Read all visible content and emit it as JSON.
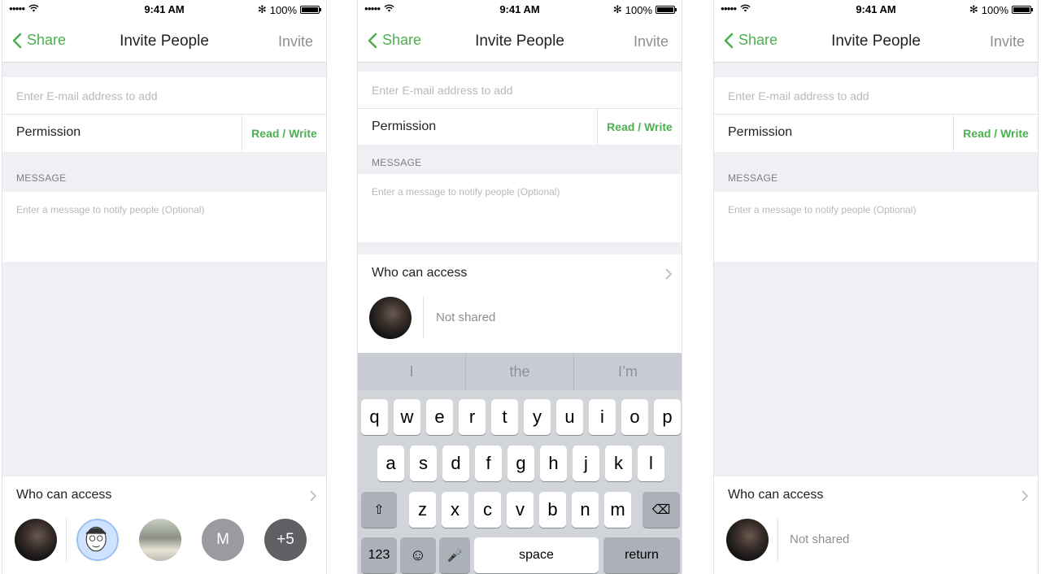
{
  "status_bar": {
    "signal": "●●●●●",
    "time": "9:41 AM",
    "bluetooth": "✻",
    "battery_pct": "100%"
  },
  "nav": {
    "back_label": "Share",
    "title": "Invite People",
    "action_label": "Invite"
  },
  "form": {
    "email_placeholder": "Enter E-mail address to add",
    "permission_label": "Permission",
    "permission_value": "Read / Write",
    "message_section": "MESSAGE",
    "message_placeholder": "Enter a message to notify people (Optional)"
  },
  "access": {
    "title": "Who can access",
    "not_shared": "Not shared",
    "shared_avatars": [
      {
        "kind": "photo-dark"
      },
      {
        "kind": "cartoon"
      },
      {
        "kind": "photo-light"
      },
      {
        "kind": "letter",
        "label": "M"
      },
      {
        "kind": "more",
        "label": "+5"
      }
    ]
  },
  "keyboard": {
    "suggestions": [
      "I",
      "the",
      "I’m"
    ],
    "row1": [
      "q",
      "w",
      "e",
      "r",
      "t",
      "y",
      "u",
      "i",
      "o",
      "p"
    ],
    "row2": [
      "a",
      "s",
      "d",
      "f",
      "g",
      "h",
      "j",
      "k",
      "l"
    ],
    "row3": [
      "z",
      "x",
      "c",
      "v",
      "b",
      "n",
      "m"
    ],
    "numbers_label": "123",
    "emoji": "☺",
    "mic": "🎤",
    "space_label": "space",
    "return_label": "return",
    "shift": "⇧",
    "delete": "⌫"
  },
  "colors": {
    "accent": "#4caf50",
    "background": "#efeff4"
  }
}
